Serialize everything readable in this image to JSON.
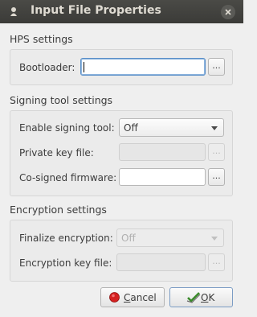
{
  "window": {
    "title": "Input File Properties",
    "icon": "app-icon",
    "close_icon": "close-icon"
  },
  "hps": {
    "section_title": "HPS settings",
    "bootloader_label": "Bootloader:",
    "bootloader_value": "",
    "browse_label": "..."
  },
  "signing": {
    "section_title": "Signing tool settings",
    "enable_label": "Enable signing tool:",
    "enable_value": "Off",
    "private_key_label": "Private key file:",
    "private_key_value": "",
    "private_key_browse": "...",
    "cosigned_label": "Co-signed firmware:",
    "cosigned_value": "",
    "cosigned_browse": "..."
  },
  "encryption": {
    "section_title": "Encryption settings",
    "finalize_label": "Finalize encryption:",
    "finalize_value": "Off",
    "key_file_label": "Encryption key file:",
    "key_file_value": "",
    "key_file_browse": "..."
  },
  "buttons": {
    "cancel_prefix": "C",
    "cancel_rest": "ancel",
    "cancel_icon": "cancel-icon",
    "ok_prefix": "O",
    "ok_rest": "K",
    "ok_icon": "ok-icon"
  },
  "colors": {
    "title_bar": "#3f3f3c",
    "focus_border": "#5a8fc8",
    "cancel_red": "#d42020",
    "ok_green": "#3a8a2a"
  }
}
